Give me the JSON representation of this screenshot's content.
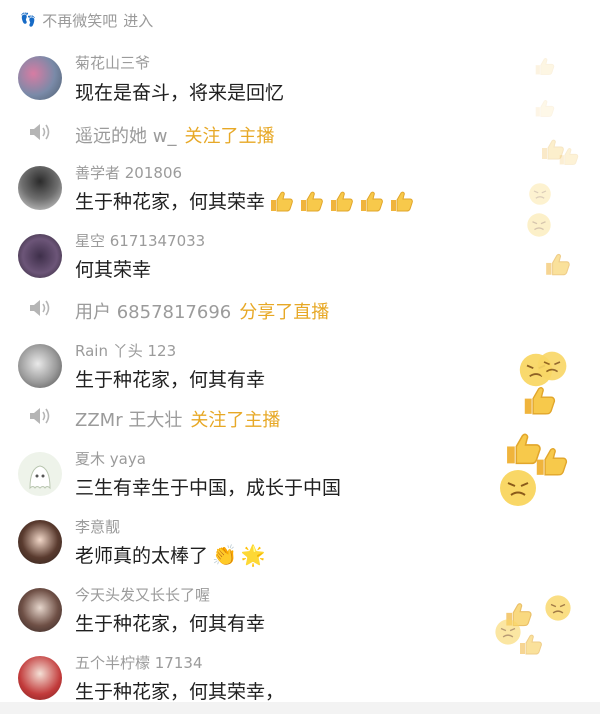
{
  "topbar": {
    "text": "不再微笑吧",
    "action": "进入"
  },
  "messages": [
    {
      "type": "chat",
      "user": "菊花山三爷",
      "text": "现在是奋斗，将来是回忆"
    },
    {
      "type": "system",
      "user": "遥远的她 w_",
      "action": "关注了主播"
    },
    {
      "type": "chat",
      "user": "善学者 201806",
      "text": "生于种花家，何其荣幸"
    },
    {
      "type": "chat",
      "user": "星空 6171347033",
      "text": "何其荣幸"
    },
    {
      "type": "system",
      "user": "用户 6857817696",
      "action": "分享了直播"
    },
    {
      "type": "chat",
      "user": "Rain 丫头 123",
      "text": "生于种花家，何其有幸"
    },
    {
      "type": "system",
      "user": "ZZMr 王大壮",
      "action": "关注了主播"
    },
    {
      "type": "chat",
      "user": "夏木 yaya",
      "text": "三生有幸生于中国，成长于中国"
    },
    {
      "type": "chat",
      "user": "李意靓",
      "text": "老师真的太棒了"
    },
    {
      "type": "chat",
      "user": "今天头发又长长了喔",
      "text": "生于种花家，何其有幸"
    },
    {
      "type": "chat",
      "user": "五个半柠檬 17134",
      "text": "生于种花家，何其荣幸，"
    }
  ],
  "icons": {
    "speaker": "speaker-icon",
    "thumbs_up": "thumbs-up-icon",
    "clap": "clap-icon",
    "sparkle": "sparkle-icon"
  },
  "colors": {
    "action": "#e7a826",
    "name": "#9b9b9b",
    "message": "#1f1f1f"
  }
}
